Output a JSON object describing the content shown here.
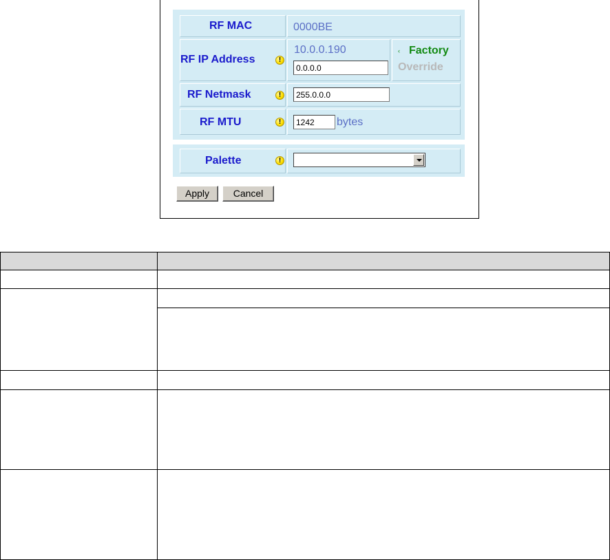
{
  "panel": {
    "rf_mac": {
      "label": "RF MAC",
      "value": "0000BE"
    },
    "rf_ip": {
      "label": "RF IP Address",
      "current": "10.0.0.190",
      "input": "0.0.0.0",
      "factory_label": "Factory",
      "override_label": "Override"
    },
    "rf_netmask": {
      "label": "RF Netmask",
      "input": "255.0.0.0"
    },
    "rf_mtu": {
      "label": "RF MTU",
      "input": "1242",
      "unit": "bytes"
    },
    "palette": {
      "label": "Palette",
      "selected": ""
    },
    "buttons": {
      "apply": "Apply",
      "cancel": "Cancel"
    }
  },
  "colors": {
    "cell_bg": "#d4ecf5",
    "label": "#1a1acc",
    "value": "#5b6fc6",
    "factory": "#138a13",
    "override": "#b8b8b8",
    "header_bg": "#d9d9d9"
  }
}
